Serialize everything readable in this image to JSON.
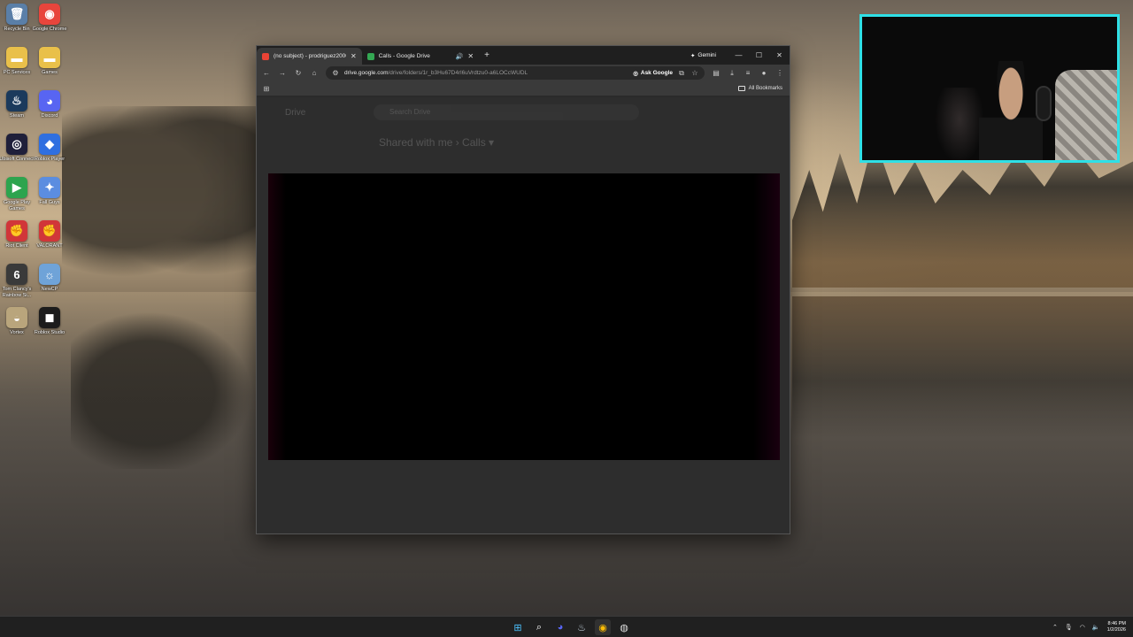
{
  "desktop": {
    "icons": [
      {
        "label": "Recycle Bin",
        "glyph": "🗑",
        "color": "#5a7fa8"
      },
      {
        "label": "Google Chrome",
        "glyph": "◉",
        "color": "#e8453c"
      },
      {
        "label": "PC Services",
        "glyph": "▬",
        "color": "#e9c04a"
      },
      {
        "label": "Games",
        "glyph": "▬",
        "color": "#e9c04a"
      },
      {
        "label": "Steam",
        "glyph": "♨",
        "color": "#1b3a5c"
      },
      {
        "label": "Discord",
        "glyph": "◕",
        "color": "#5865f2"
      },
      {
        "label": "Ubisoft Connect",
        "glyph": "◎",
        "color": "#1f1f3a"
      },
      {
        "label": "Roblox Player",
        "glyph": "◆",
        "color": "#2f6fe0"
      },
      {
        "label": "Google Play Games",
        "glyph": "▶",
        "color": "#2da44e"
      },
      {
        "label": "Fall Guys",
        "glyph": "✦",
        "color": "#5b8de0"
      },
      {
        "label": "Riot Client",
        "glyph": "✊",
        "color": "#d13639"
      },
      {
        "label": "VALORANT",
        "glyph": "✊",
        "color": "#d13639"
      },
      {
        "label": "Tom Clancy's Rainbow Si...",
        "glyph": "6",
        "color": "#3a3a3a"
      },
      {
        "label": "NewCP",
        "glyph": "☼",
        "color": "#6fa3d8"
      },
      {
        "label": "Vortex",
        "glyph": "◒",
        "color": "#b9a57c"
      },
      {
        "label": "Roblox Studio",
        "glyph": "◼",
        "color": "#1c1c1c"
      }
    ]
  },
  "browser": {
    "tabs": [
      {
        "title": "(no subject) - prodriguez2000",
        "favicon_color": "#ea4335",
        "active": true
      },
      {
        "title": "Calls - Google Drive",
        "favicon_color": "#34a853",
        "active": false
      }
    ],
    "audio_icon": "🔊",
    "new_tab": "+",
    "gemini_label": "Gemini",
    "window_controls": {
      "minimize": "—",
      "maximize": "☐",
      "close": "✕"
    },
    "url_host": "drive.google.com",
    "url_path": "/drive/folders/1r_b3Hu67D4rl6uVrdtzu0-a6LOCcWUDL",
    "ask_google_label": "Ask Google",
    "all_bookmarks_label": "All Bookmarks",
    "drive": {
      "title": "Drive",
      "search_placeholder": "Search Drive",
      "heading": "Shared with me  ›  Calls ▾"
    }
  },
  "taskbar": {
    "apps": [
      {
        "name": "start",
        "glyph": "⊞",
        "color": "#4cc2ff"
      },
      {
        "name": "search",
        "glyph": "⌕",
        "color": "#ffffff"
      },
      {
        "name": "discord",
        "glyph": "◕",
        "color": "#5865f2"
      },
      {
        "name": "steam",
        "glyph": "♨",
        "color": "#c7d5e0"
      },
      {
        "name": "chrome",
        "glyph": "◉",
        "color": "#fbbc05"
      },
      {
        "name": "obs",
        "glyph": "◍",
        "color": "#dddddd"
      }
    ],
    "tray": {
      "chevron": "⌃",
      "mic": "🎙",
      "wifi": "◠",
      "volume": "🔈"
    },
    "time": "8:46 PM",
    "date": "1/2/2026"
  }
}
